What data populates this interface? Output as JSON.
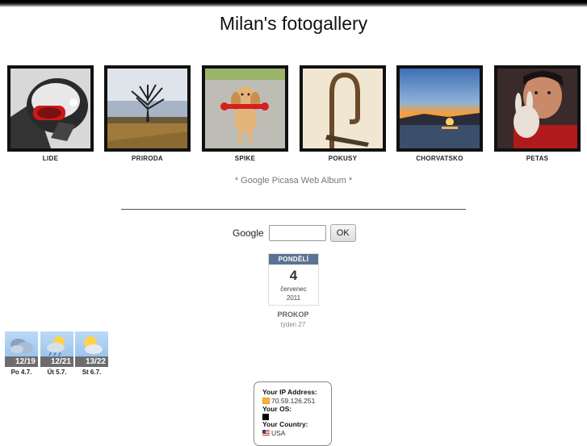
{
  "site": {
    "title": "Milan's fotogallery"
  },
  "albums": [
    {
      "label": "LIDE",
      "icon": "helmet-portrait-thumbnail"
    },
    {
      "label": "PRIRODA",
      "icon": "tree-landscape-thumbnail"
    },
    {
      "label": "SPIKE",
      "icon": "dog-thumbnail"
    },
    {
      "label": "POKUSY",
      "icon": "hook-thumbnail"
    },
    {
      "label": "CHORVATSKO",
      "icon": "sunset-thumbnail"
    },
    {
      "label": "PETAS",
      "icon": "person-with-bunny-thumbnail"
    }
  ],
  "picasa_link": "* Google Picasa Web Album *",
  "search": {
    "label": "Google",
    "value": "",
    "button": "OK"
  },
  "calendar": {
    "weekday": "PONDĚLÍ",
    "day": "4",
    "month": "červenec",
    "year": "2011",
    "nameday": "PROKOP",
    "week": "týden 27",
    "header_color": "#5c7391"
  },
  "weather": [
    {
      "temp": "12/19",
      "label": "Po 4.7.",
      "icon": "cloudy-icon"
    },
    {
      "temp": "12/21",
      "label": "Út 5.7.",
      "icon": "partly-cloudy-rain-icon"
    },
    {
      "temp": "13/22",
      "label": "St 6.7.",
      "icon": "partly-cloudy-icon"
    }
  ],
  "ipinfo": {
    "ip_heading": "Your IP Address:",
    "ip_value": "70.59.126.251",
    "os_heading": "Your OS:",
    "country_heading": "Your Country:",
    "country_value": "USA"
  }
}
